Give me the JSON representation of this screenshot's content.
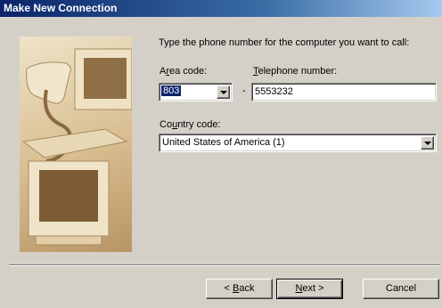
{
  "window": {
    "title": "Make New Connection"
  },
  "instructions": "Type the phone number for the computer you want to call:",
  "area_code": {
    "label_prefix": "A",
    "label_underlined": "r",
    "label_rest": "ea code:",
    "value": "803"
  },
  "dash": "-",
  "telephone": {
    "label_underlined": "T",
    "label_rest": "elephone number:",
    "value": "5553232"
  },
  "country": {
    "label_prefix": "Co",
    "label_underlined": "u",
    "label_rest": "ntry code:",
    "value": "United States of America (1)"
  },
  "buttons": {
    "back_arrow": "< ",
    "back_underlined": "B",
    "back_rest": "ack",
    "next_underlined": "N",
    "next_rest": "ext >",
    "cancel": "Cancel"
  },
  "colors": {
    "titlebar_start": "#0a246a",
    "titlebar_end": "#a6caf0",
    "dialog_face": "#d4d0c8",
    "selection": "#0a246a"
  }
}
